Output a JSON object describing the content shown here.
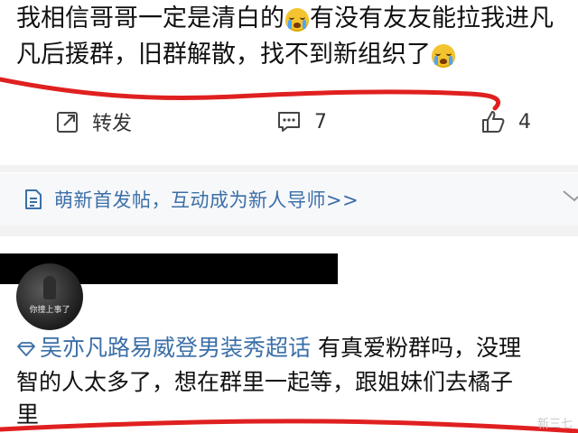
{
  "post1": {
    "line1_a": "我相信哥哥一定是清白的",
    "line1_b": "有没有友友能拉我进凡",
    "line2_a": "凡后援群，旧群解散，找不到新组织了",
    "emoji_icon": "crying-face-icon"
  },
  "actions": {
    "repost_label": "转发",
    "comment_count": "7",
    "like_count": "4"
  },
  "banner": {
    "text": "萌新首发帖，互动成为新人导师>>"
  },
  "post2": {
    "avatar_caption": "你撞上事了",
    "topic": "吴亦凡路易威登男装秀超话",
    "line1_rest": " 有真爱粉群吗，没理",
    "line2": "智的人太多了，想在群里一起等，跟姐妹们去橘子",
    "line3": "里"
  },
  "watermark": "新三七"
}
